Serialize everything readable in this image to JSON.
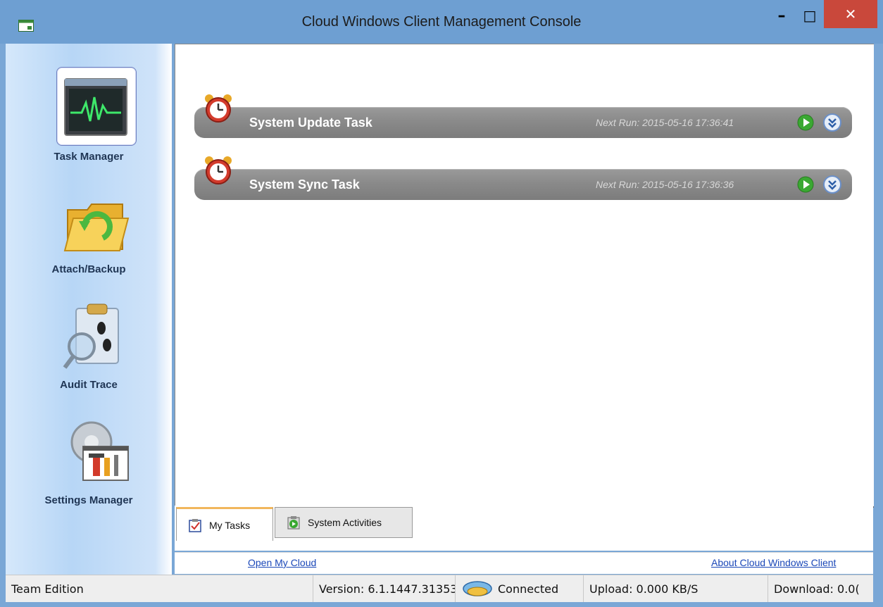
{
  "window": {
    "title": "Cloud Windows Client Management Console",
    "controls": {
      "minimize": "–",
      "maximize": "□",
      "close": "✕"
    }
  },
  "sidebar": {
    "items": [
      {
        "label": "Task Manager",
        "icon": "task-manager-icon",
        "selected": true
      },
      {
        "label": "Attach/Backup",
        "icon": "folder-backup-icon",
        "selected": false
      },
      {
        "label": "Audit Trace",
        "icon": "audit-trace-icon",
        "selected": false
      },
      {
        "label": "Settings Manager",
        "icon": "settings-tools-icon",
        "selected": false
      }
    ]
  },
  "tasks": [
    {
      "name": "System Update Task",
      "next_run": "Next Run: 2015-05-16 17:36:41"
    },
    {
      "name": "System Sync Task",
      "next_run": "Next Run: 2015-05-16 17:36:36"
    }
  ],
  "tabs": [
    {
      "label": "My Tasks",
      "icon": "checklist-icon",
      "active": true
    },
    {
      "label": "System Activities",
      "icon": "activities-icon",
      "active": false
    }
  ],
  "links": {
    "open_cloud": "Open My Cloud",
    "about": "About Cloud Windows Client"
  },
  "status": {
    "edition": "Team Edition",
    "version": "Version: 6.1.1447.31353",
    "connection": "Connected",
    "upload": "Upload: 0.000 KB/S",
    "download": "Download: 0.0("
  },
  "colors": {
    "titlebar": "#6e9fd2",
    "task_bar": "#8a8a8a",
    "play_green": "#3aa832",
    "link_blue": "#1a47b8",
    "close_red": "#c9483b"
  }
}
